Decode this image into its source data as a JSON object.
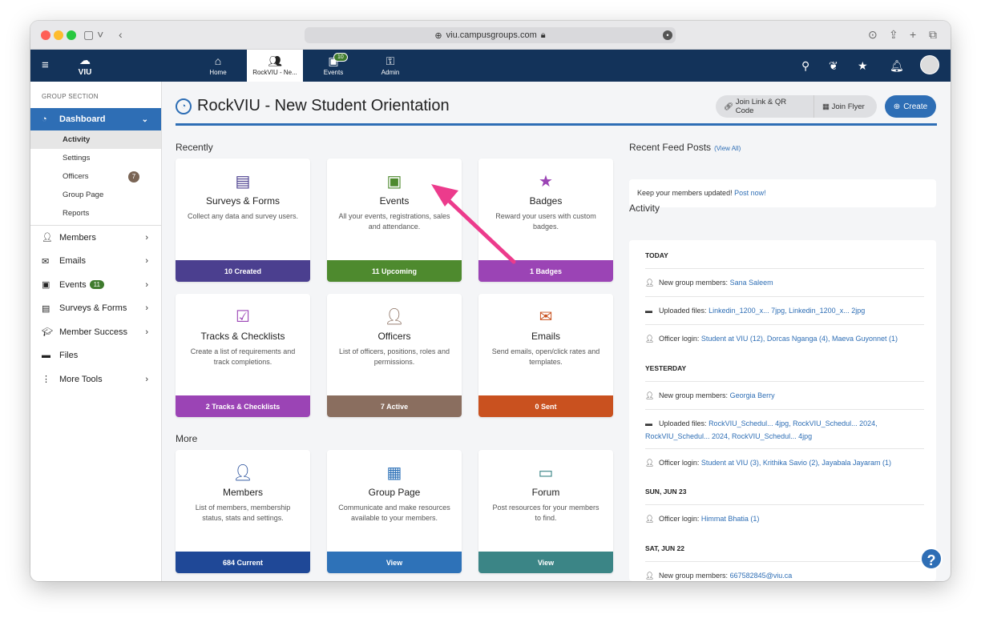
{
  "browser": {
    "url": "viu.campusgroups.com"
  },
  "navbar": {
    "logo": "VIU",
    "items": [
      {
        "label": "Home"
      },
      {
        "label": "RockVIU - Ne..."
      },
      {
        "label": "Events",
        "badge": "10"
      },
      {
        "label": "Admin"
      }
    ]
  },
  "sidebar": {
    "section_label": "GROUP SECTION",
    "dashboard_label": "Dashboard",
    "subitems": [
      {
        "label": "Activity"
      },
      {
        "label": "Settings"
      },
      {
        "label": "Officers",
        "count": "7"
      },
      {
        "label": "Group Page"
      },
      {
        "label": "Reports"
      }
    ],
    "items": [
      {
        "label": "Members"
      },
      {
        "label": "Emails"
      },
      {
        "label": "Events",
        "badge": "11"
      },
      {
        "label": "Surveys & Forms"
      },
      {
        "label": "Member Success"
      },
      {
        "label": "Files"
      },
      {
        "label": "More Tools"
      }
    ]
  },
  "header": {
    "title": "RockVIU - New Student Orientation",
    "join_link_label": "Join Link & QR Code",
    "join_flyer_label": "Join Flyer",
    "create_label": "Create"
  },
  "recently": {
    "label": "Recently",
    "cards": [
      {
        "title": "Surveys & Forms",
        "desc": "Collect any data and survey users.",
        "footer": "10 Created",
        "color": "#4b3f8f",
        "icon": "clipboard-icon"
      },
      {
        "title": "Events",
        "desc": "All your events, registrations, sales and attendance.",
        "footer": "11 Upcoming",
        "color": "#4e8a2e",
        "icon": "calendar-icon"
      },
      {
        "title": "Badges",
        "desc": "Reward your users with custom badges.",
        "footer": "1 Badges",
        "color": "#9b44b5",
        "icon": "badge-icon"
      },
      {
        "title": "Tracks & Checklists",
        "desc": "Create a list of requirements and track completions.",
        "footer": "2 Tracks & Checklists",
        "color": "#9b44b5",
        "icon": "checklist-icon"
      },
      {
        "title": "Officers",
        "desc": "List of officers, positions, roles and permissions.",
        "footer": "7 Active",
        "color": "#8a6e5f",
        "icon": "officer-icon"
      },
      {
        "title": "Emails",
        "desc": "Send emails, open/click rates and templates.",
        "footer": "0 Sent",
        "color": "#c9511f",
        "icon": "envelope-icon"
      }
    ]
  },
  "more": {
    "label": "More",
    "cards": [
      {
        "title": "Members",
        "desc": "List of members, membership status, stats and settings.",
        "footer": "684 Current",
        "color": "#1f4897",
        "icon": "person-icon"
      },
      {
        "title": "Group Page",
        "desc": "Communicate and make resources available to your members.",
        "footer": "View",
        "color": "#2e72b8",
        "icon": "page-icon"
      },
      {
        "title": "Forum",
        "desc": "Post resources for your members to find.",
        "footer": "View",
        "color": "#3b8586",
        "icon": "chat-icon"
      }
    ]
  },
  "feed": {
    "title": "Recent Feed Posts",
    "view_all": "(View All)",
    "text": "Keep your members updated!",
    "link": "Post now!"
  },
  "activity": {
    "title": "Activity",
    "groups": [
      {
        "date": "TODAY",
        "rows": [
          {
            "prefix": "New group members:",
            "links": "Sana Saleem"
          },
          {
            "prefix": "Uploaded files:",
            "links": "Linkedin_1200_x... 7jpg, Linkedin_1200_x... 2jpg"
          },
          {
            "prefix": "Officer login:",
            "links": "Student at VIU (12), Dorcas Nganga (4), Maeva Guyonnet (1)"
          }
        ]
      },
      {
        "date": "YESTERDAY",
        "rows": [
          {
            "prefix": "New group members:",
            "links": "Georgia Berry"
          },
          {
            "prefix": "Uploaded files:",
            "links": "RockVIU_Schedul... 4jpg, RockVIU_Schedul... 2024, RockVIU_Schedul... 2024, RockVIU_Schedul... 4jpg"
          },
          {
            "prefix": "Officer login:",
            "links": "Student at VIU (3), Krithika Savio (2), Jayabala Jayaram (1)"
          }
        ]
      },
      {
        "date": "SUN, JUN 23",
        "rows": [
          {
            "prefix": "Officer login:",
            "links": "Himmat Bhatia (1)"
          }
        ]
      },
      {
        "date": "SAT, JUN 22",
        "rows": [
          {
            "prefix": "New group members:",
            "links": "667582845@viu.ca"
          }
        ]
      }
    ]
  },
  "help_label": "?"
}
